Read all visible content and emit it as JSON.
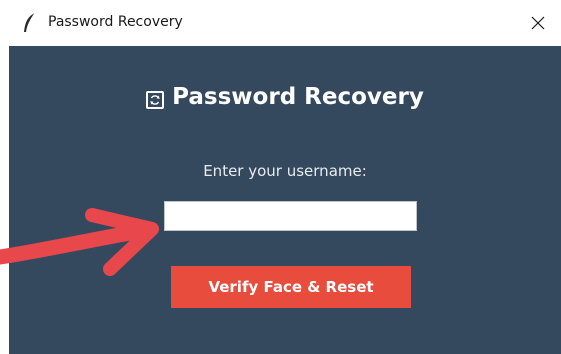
{
  "window": {
    "title": "Password Recovery",
    "app_icon": "feather-icon",
    "close_icon": "close-icon"
  },
  "form": {
    "heading": "Password Recovery",
    "heading_icon": "refresh-icon",
    "prompt": "Enter your username:",
    "username_value": "",
    "username_placeholder": "",
    "verify_button_label": "Verify Face & Reset"
  },
  "annotation": {
    "arrow_icon": "red-arrow-icon"
  },
  "colors": {
    "panel_bg": "#34495e",
    "button_bg": "#e74c3c",
    "arrow": "#e8474c",
    "text_light": "#ffffff"
  }
}
